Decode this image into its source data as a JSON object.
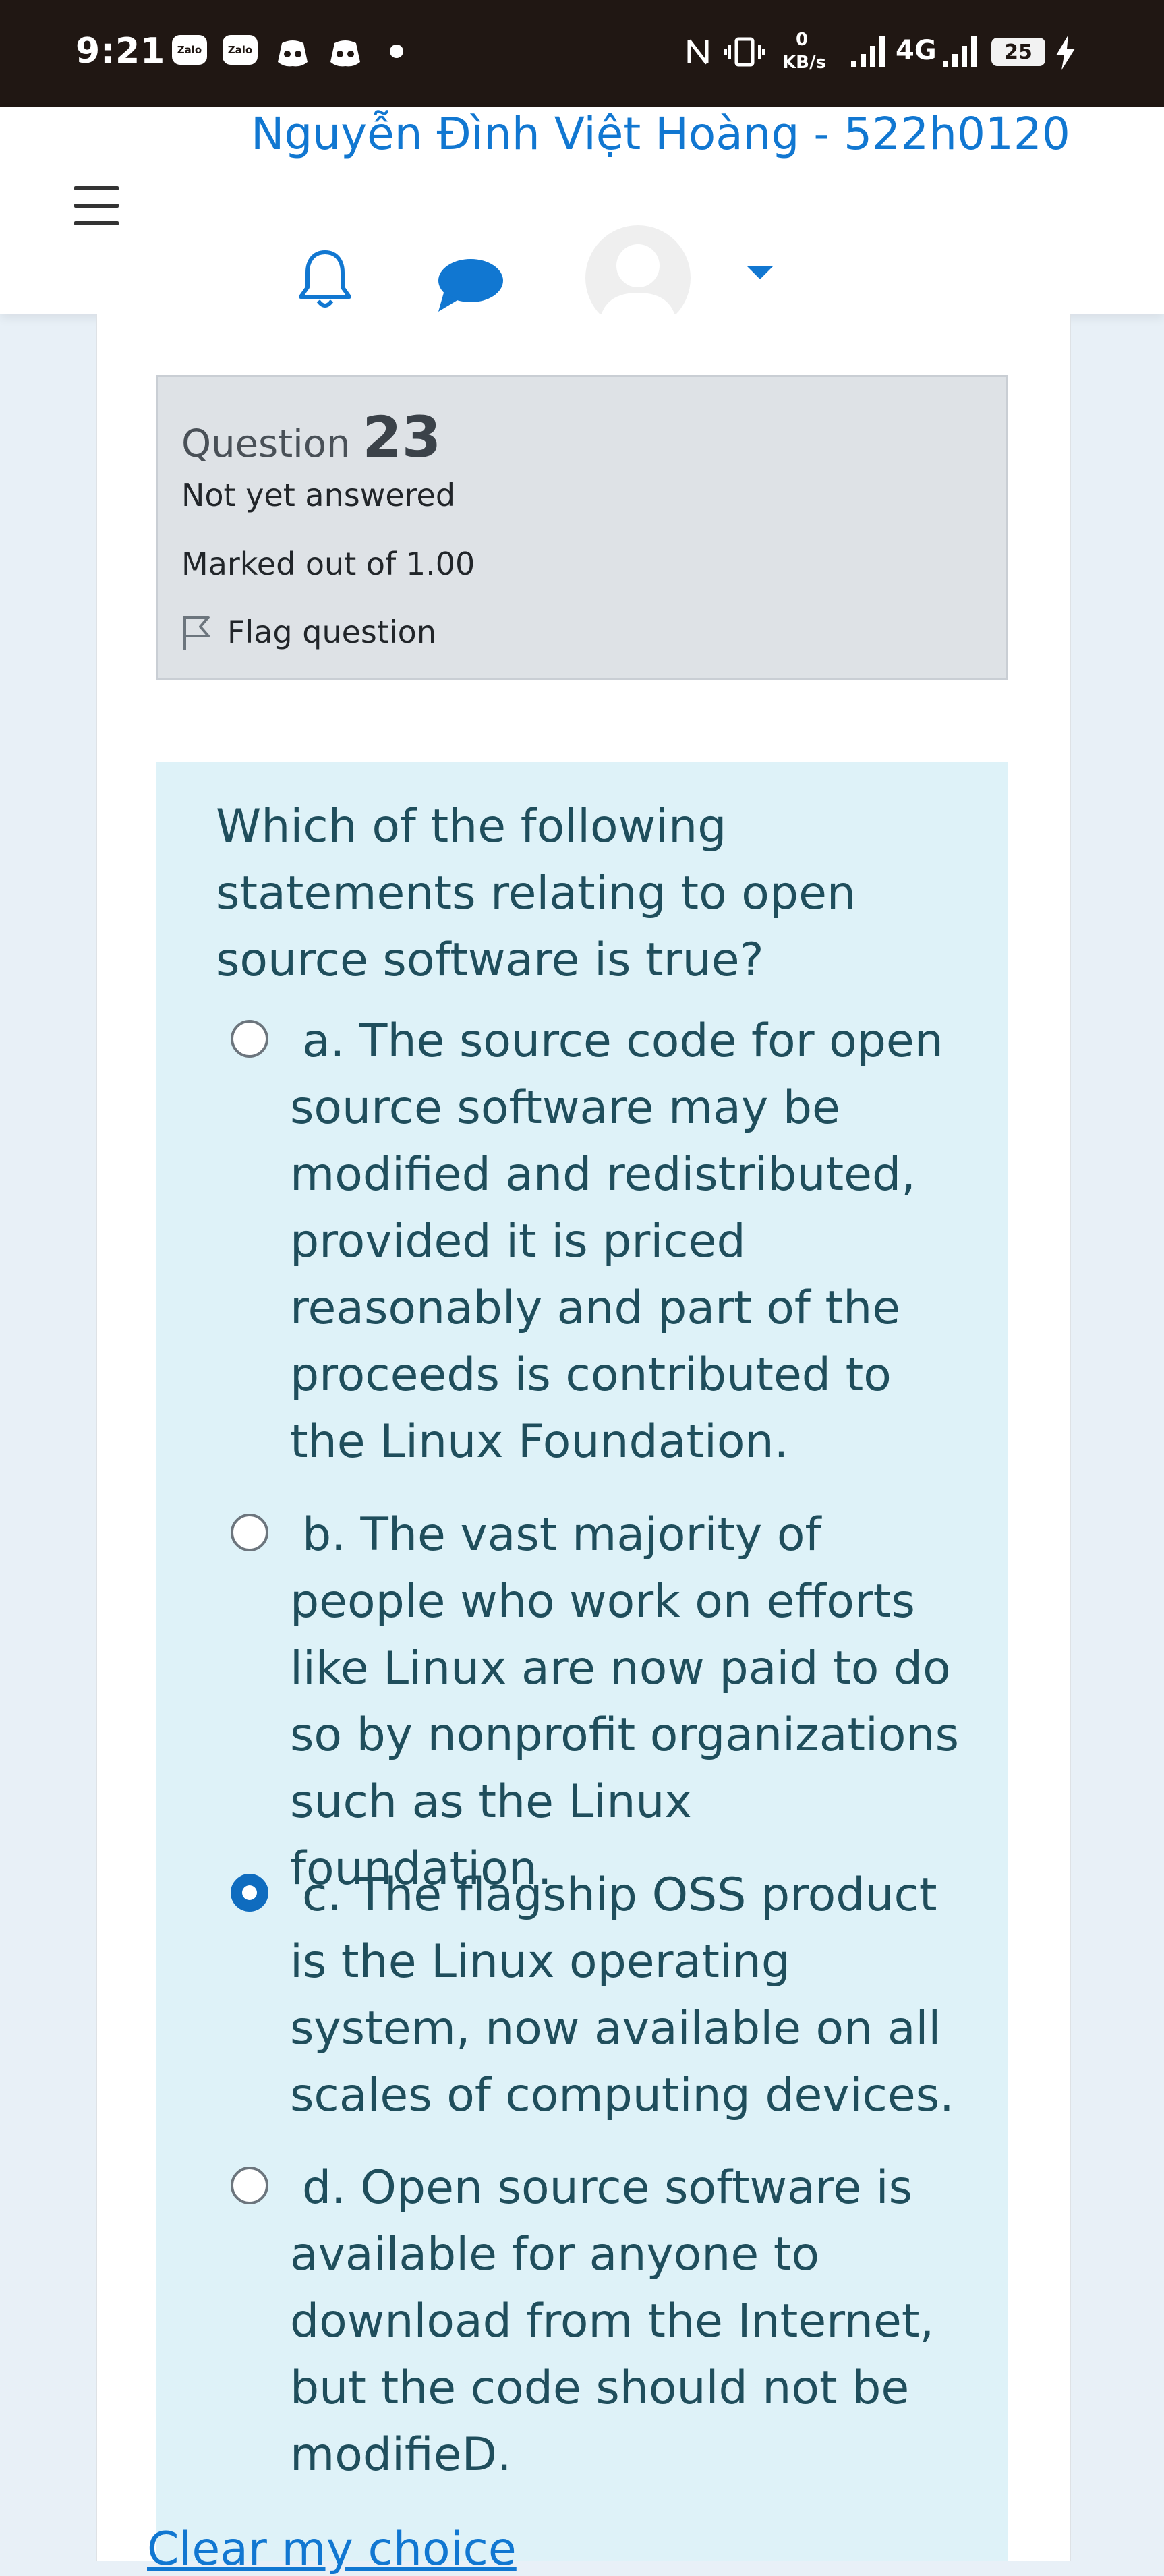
{
  "status_bar": {
    "time": "9:21",
    "notification_icons": [
      "zalo-icon",
      "zalo-icon",
      "discord-icon",
      "discord-icon",
      "dot-icon"
    ],
    "zalo_label": "Zalo",
    "net_speed_value": "0",
    "net_speed_unit": "KB/s",
    "network": "4G",
    "battery": "25"
  },
  "header": {
    "user_name": "Nguyễn Đình Việt Hoàng - 522h0120",
    "icons": [
      "menu-icon",
      "bell-icon",
      "chat-icon",
      "avatar",
      "caret-down-icon"
    ],
    "accent_color": "#1177d1"
  },
  "question_info": {
    "label": "Question",
    "number": "23",
    "state": "Not yet answered",
    "grade": "Marked out of 1.00",
    "flag_label": "Flag question"
  },
  "question": {
    "text": "Which of the following statements relating to open source software is true?",
    "answers": [
      {
        "label": "a. The source code for open source software may be modified and redistributed, provided it is priced reasonably and part of the proceeds is contributed to the Linux Foundation.",
        "selected": false
      },
      {
        "label": "b. The vast majority of people who work on efforts like Linux are now paid to do so by nonprofit organizations such as the Linux foundation.",
        "selected": false
      },
      {
        "label": "c. The flagship OSS product is the Linux operating system, now available on all scales of computing devices.",
        "selected": true
      },
      {
        "label": "d. Open source software is available for anyone to download from the Internet, but the code should not be modifieD.",
        "selected": false
      }
    ],
    "clear_label": "Clear my choice"
  }
}
